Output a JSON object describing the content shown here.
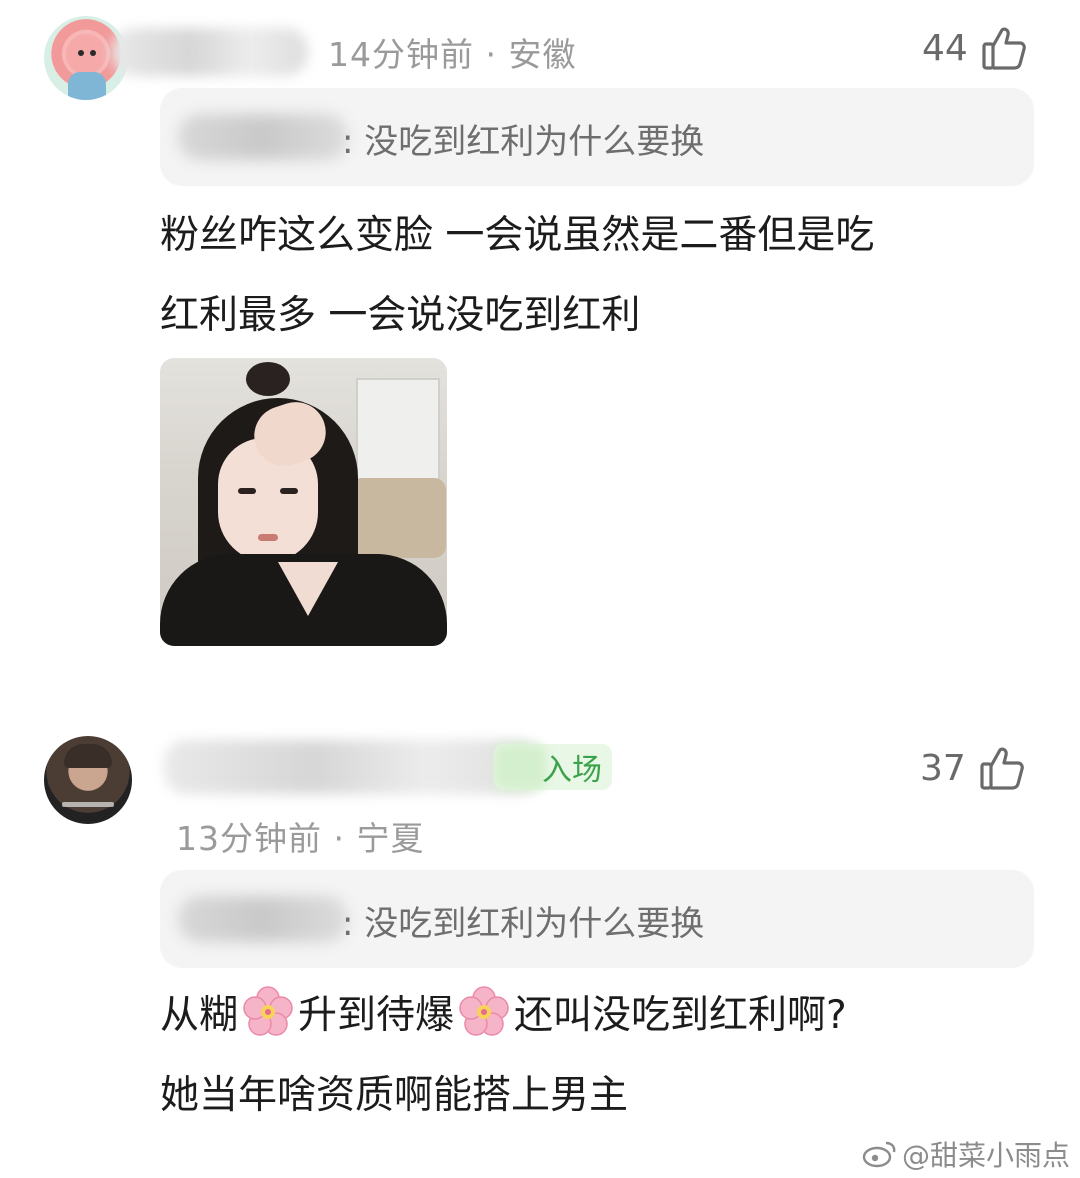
{
  "comments": [
    {
      "time_location": "14分钟前 · 安徽",
      "likes": "44",
      "quote_text": ": 没吃到红利为什么要换",
      "text_lines": [
        "粉丝咋这么变脸 一会说虽然是二番但是吃",
        "红利最多 一会说没吃到红利"
      ]
    },
    {
      "badge_text": "入场",
      "time_location": "13分钟前 · 宁夏",
      "likes": "37",
      "quote_text": ": 没吃到红利为什么要换",
      "text_part1": "从糊",
      "text_part2": "升到待爆",
      "text_part3": "还叫没吃到红利啊?",
      "text_line2": "她当年啥资质啊能搭上男主"
    }
  ],
  "watermark": "@甜菜小雨点",
  "icons": {
    "like": "thumbs-up-icon",
    "flower": "cherry-blossom-icon",
    "weibo": "weibo-logo-icon"
  },
  "colors": {
    "badge_text": "#3aa24a",
    "meta": "#9a9a9a",
    "quote_bg": "#f4f4f4"
  }
}
